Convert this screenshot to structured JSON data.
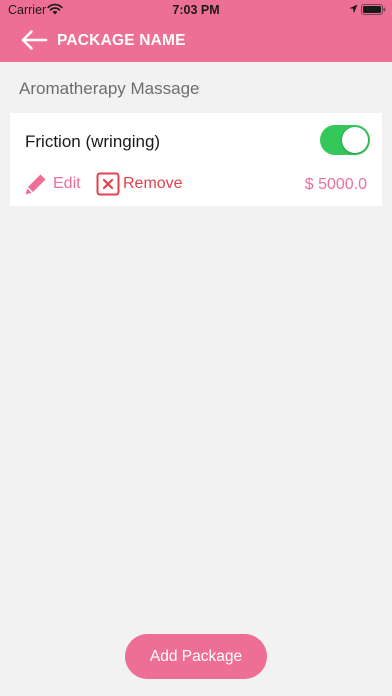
{
  "status_bar": {
    "carrier": "Carrier",
    "time": "7:03 PM"
  },
  "header": {
    "title": "PACKAGE NAME",
    "back_icon": "arrow-left-icon",
    "color": "#ee6f96"
  },
  "section": {
    "title": "Aromatherapy Massage"
  },
  "package_item": {
    "name": "Friction (wringing)",
    "enabled": true,
    "edit_label": "Edit",
    "edit_icon": "pencil-icon",
    "remove_label": "Remove",
    "remove_icon": "close-box-icon",
    "price": "$ 5000.0"
  },
  "footer": {
    "add_button_label": "Add Package"
  },
  "colors": {
    "accent": "#ee6f96",
    "toggle_on": "#34c759",
    "remove": "#e6404c",
    "background": "#f2f2f2"
  }
}
